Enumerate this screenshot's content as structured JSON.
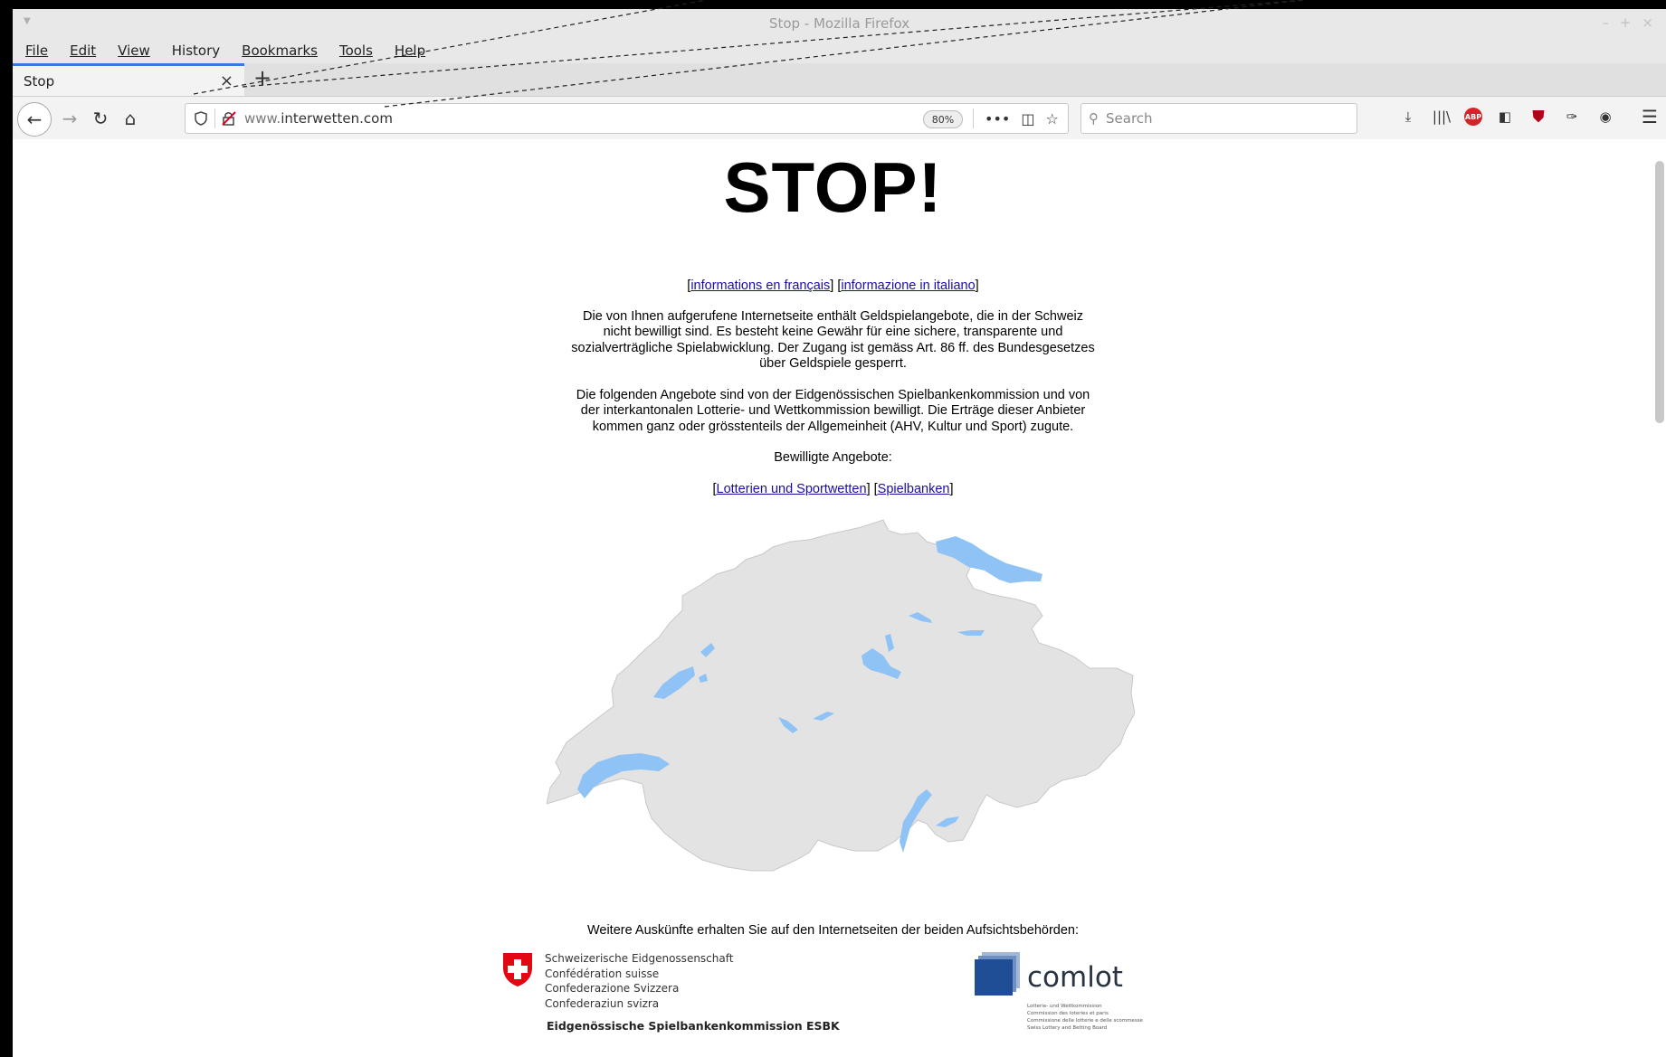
{
  "window": {
    "title": "Stop - Mozilla Firefox",
    "controls": [
      "–",
      "+",
      "×"
    ]
  },
  "menu": {
    "file": "File",
    "edit": "Edit",
    "view": "View",
    "history": "History",
    "bookmarks": "Bookmarks",
    "tools": "Tools",
    "help": "Help"
  },
  "tab": {
    "title": "Stop",
    "close": "×",
    "new": "+"
  },
  "nav": {
    "back": "←",
    "forward": "→",
    "reload": "↻",
    "home": "⌂"
  },
  "url": {
    "domain_prefix": "www.",
    "domain": "interwetten.com",
    "zoom": "80%"
  },
  "url_actions": {
    "more": "•••",
    "pocket": "◫",
    "star": "☆"
  },
  "search": {
    "placeholder": "Search",
    "icon": "⚲"
  },
  "toolbar": {
    "download": "⤓",
    "library": "|||\\",
    "abp": "ABP",
    "sidebar": "◧",
    "ublock": "⛊",
    "ext": "✑",
    "account": "◉",
    "menu": "☰"
  },
  "page": {
    "heading": "STOP!",
    "lang_fr": "informations en français",
    "lang_it": "informazione in italiano",
    "para1": "Die von Ihnen aufgerufene Internetseite enthält Geldspielangebote, die in der Schweiz nicht bewilligt sind. Es besteht keine Gewähr für eine sichere, transparente und sozialverträgliche Spielabwicklung. Der Zugang ist gemäss Art. 86 ff. des Bundesgesetzes über Geldspiele gesperrt.",
    "para2": "Die folgenden Angebote sind von der Eidgenössischen Spielbankenkommission und von der interkantonalen Lotterie- und Wettkommission bewilligt. Die Erträge dieser Anbieter kommen ganz oder grösstenteils der Allgemeinheit (AHV, Kultur und Sport) zugute.",
    "approved_label": "Bewilligte Angebote:",
    "link_lotteries": "Lotterien und Sportwetten",
    "link_casinos": "Spielbanken",
    "footer": "Weitere Auskünfte erhalten Sie auf den Internetseiten der beiden Aufsichtsbehörden:",
    "ch_line1": "Schweizerische Eidgenossenschaft",
    "ch_line2": "Confédération suisse",
    "ch_line3": "Confederazione Svizzera",
    "ch_line4": "Confederaziun svizra",
    "esbk": "Eidgenössische Spielbankenkommission ESBK",
    "comlot": "comlot",
    "comlot_l1": "Lotterie- und Wettkommission",
    "comlot_l2": "Commission des loteries et paris",
    "comlot_l3": "Commissione delle lotterie e delle scommesse",
    "comlot_l4": "Swiss Lottery and Betting Board"
  },
  "colors": {
    "accent": "#3c78d8",
    "map_land": "#e3e3e3",
    "map_water": "#8fc3f5",
    "swiss_red": "#e30613",
    "link": "#1a0dab"
  }
}
